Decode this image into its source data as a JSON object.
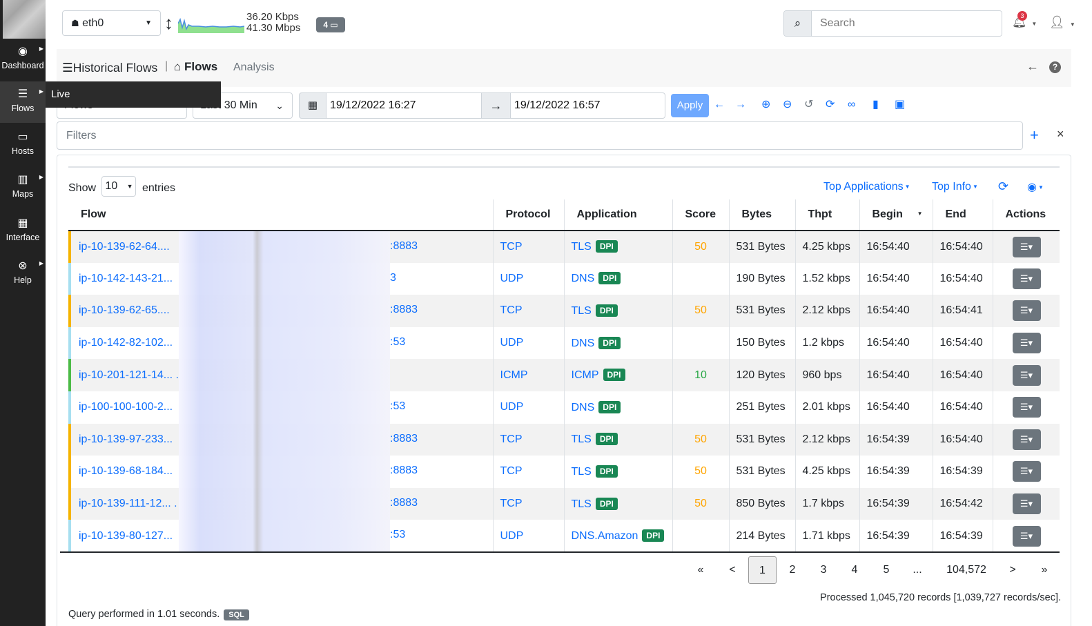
{
  "sidebar": {
    "items": [
      {
        "label": "Dashboard",
        "icon": "gauge-icon",
        "glyph": "◉"
      },
      {
        "label": "Flows",
        "icon": "bars-icon",
        "glyph": "☰"
      },
      {
        "label": "Hosts",
        "icon": "laptop-icon",
        "glyph": "▭"
      },
      {
        "label": "Maps",
        "icon": "map-icon",
        "glyph": "▥"
      },
      {
        "label": "Interface",
        "icon": "ethernet-icon",
        "glyph": "▦"
      },
      {
        "label": "Help",
        "icon": "lifering-icon",
        "glyph": "⊗"
      }
    ],
    "submenu_label": "Live"
  },
  "topbar": {
    "interface": "eth0",
    "rate_up": "36.20 Kbps",
    "rate_down": "41.30 Mbps",
    "devices_badge": "4",
    "search_placeholder": "Search",
    "notification_count": "3"
  },
  "header": {
    "title": "Historical Flows",
    "separator": "|",
    "flows_label": "Flows",
    "analysis_label": "Analysis"
  },
  "controls": {
    "mode_value": "Flows",
    "range_value": "Last 30 Min",
    "begin_date": "19/12/2022 16:27",
    "end_date": "19/12/2022 16:57",
    "apply_label": "Apply",
    "filters_placeholder": "Filters"
  },
  "table_controls": {
    "show_label": "Show",
    "show_value": "10",
    "entries_label": "entries",
    "top_applications": "Top Applications",
    "top_info": "Top Info"
  },
  "table": {
    "headers": [
      "Flow",
      "Protocol",
      "Application",
      "Score",
      "Bytes",
      "Thpt",
      "Begin",
      "End",
      "Actions"
    ],
    "dpi_label": "DPI",
    "rows": [
      {
        "flow": "ip-10-139-62-64....",
        "port": ":8883",
        "proto": "TCP",
        "app": "TLS",
        "score": "50",
        "bytes": "531 Bytes",
        "thpt": "4.25 kbps",
        "begin": "16:54:40",
        "end": "16:54:40",
        "bar": "#f5b400",
        "score_color": "yellow"
      },
      {
        "flow": "ip-10-142-143-21...",
        "port": "3",
        "proto": "UDP",
        "app": "DNS",
        "score": "",
        "bytes": "190 Bytes",
        "thpt": "1.52 kbps",
        "begin": "16:54:40",
        "end": "16:54:40",
        "bar": "#a7dff0",
        "score_color": "none"
      },
      {
        "flow": "ip-10-139-62-65....",
        "port": ":8883",
        "proto": "TCP",
        "app": "TLS",
        "score": "50",
        "bytes": "531 Bytes",
        "thpt": "2.12 kbps",
        "begin": "16:54:40",
        "end": "16:54:41",
        "bar": "#f5b400",
        "score_color": "yellow"
      },
      {
        "flow": "ip-10-142-82-102...",
        "port": ":53",
        "proto": "UDP",
        "app": "DNS",
        "score": "",
        "bytes": "150 Bytes",
        "thpt": "1.2 kbps",
        "begin": "16:54:40",
        "end": "16:54:40",
        "bar": "#a7dff0",
        "score_color": "none"
      },
      {
        "flow": "ip-10-201-121-14... .",
        "port": "",
        "proto": "ICMP",
        "app": "ICMP",
        "score": "10",
        "bytes": "120 Bytes",
        "thpt": "960 bps",
        "begin": "16:54:40",
        "end": "16:54:40",
        "bar": "#4cbb47",
        "score_color": "green"
      },
      {
        "flow": "ip-100-100-100-2...",
        "port": ":53",
        "proto": "UDP",
        "app": "DNS",
        "score": "",
        "bytes": "251 Bytes",
        "thpt": "2.01 kbps",
        "begin": "16:54:40",
        "end": "16:54:40",
        "bar": "#a7dff0",
        "score_color": "none"
      },
      {
        "flow": "ip-10-139-97-233...",
        "port": ":8883",
        "proto": "TCP",
        "app": "TLS",
        "score": "50",
        "bytes": "531 Bytes",
        "thpt": "2.12 kbps",
        "begin": "16:54:39",
        "end": "16:54:40",
        "bar": "#f5b400",
        "score_color": "yellow"
      },
      {
        "flow": "ip-10-139-68-184...",
        "port": ":8883",
        "proto": "TCP",
        "app": "TLS",
        "score": "50",
        "bytes": "531 Bytes",
        "thpt": "4.25 kbps",
        "begin": "16:54:39",
        "end": "16:54:39",
        "bar": "#f5b400",
        "score_color": "yellow"
      },
      {
        "flow": "ip-10-139-111-12... .",
        "port": ":8883",
        "proto": "TCP",
        "app": "TLS",
        "score": "50",
        "bytes": "850 Bytes",
        "thpt": "1.7 kbps",
        "begin": "16:54:39",
        "end": "16:54:42",
        "bar": "#f5b400",
        "score_color": "yellow"
      },
      {
        "flow": "ip-10-139-80-127...",
        "port": ":53",
        "proto": "UDP",
        "app": "DNS.Amazon",
        "score": "",
        "bytes": "214 Bytes",
        "thpt": "1.71 kbps",
        "begin": "16:54:39",
        "end": "16:54:39",
        "bar": "#a7dff0",
        "score_color": "none"
      }
    ]
  },
  "pagination": {
    "first": "«",
    "prev": "<",
    "pages": [
      "1",
      "2",
      "3",
      "4",
      "5"
    ],
    "ellipsis": "...",
    "last_page": "104,572",
    "next": ">",
    "last": "»",
    "current": "1"
  },
  "footer": {
    "processed": "Processed 1,045,720 records [1,039,727 records/sec].",
    "query": "Query performed in 1.01 seconds.",
    "sql_label": "SQL"
  }
}
